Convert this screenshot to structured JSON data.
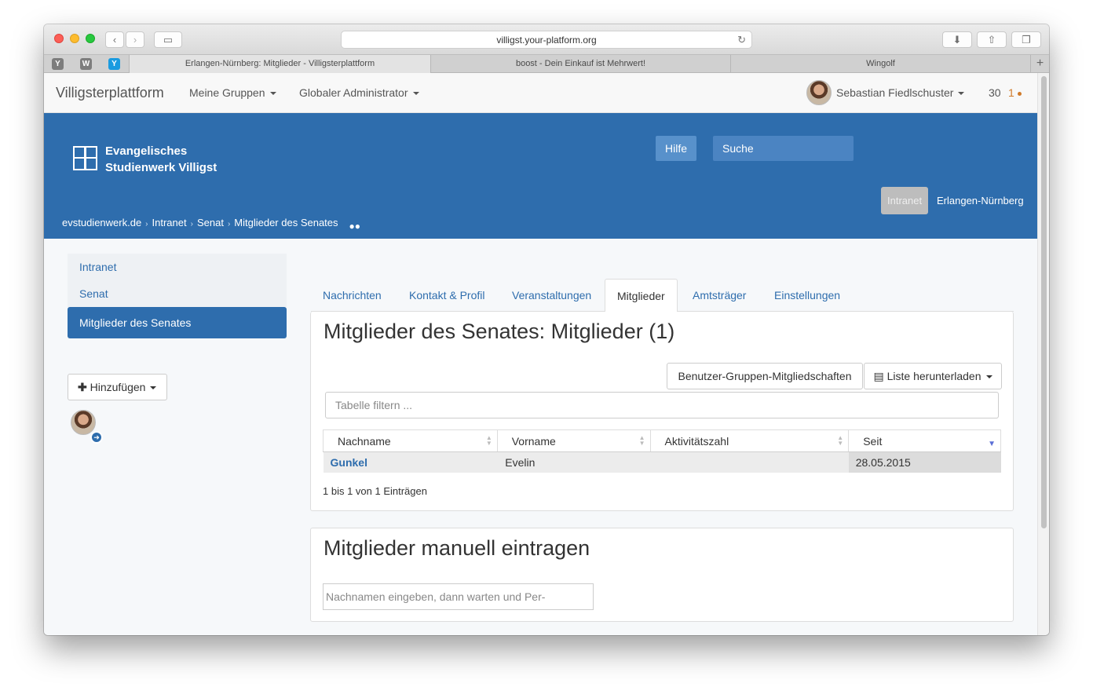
{
  "browser": {
    "url": "villigst.your-platform.org",
    "favicons": [
      "Y",
      "W",
      "Y"
    ],
    "tabs": [
      "Erlangen-Nürnberg: Mitglieder - Villigsterplattform",
      "boost - Dein Einkauf ist Mehrwert!",
      "Wingolf"
    ],
    "new_tab": "+"
  },
  "navbar": {
    "brand": "Villigsterplattform",
    "menu_groups": "Meine Gruppen",
    "menu_admin": "Globaler Administrator",
    "user_name": "Sebastian Fiedlschuster",
    "count": "30",
    "notifications": "1"
  },
  "banner": {
    "logo_line1": "Evangelisches",
    "logo_line2": "Studienwerk Villigst",
    "help": "Hilfe",
    "search_placeholder": "Suche",
    "pills": [
      "Intranet",
      "Erlangen-Nürnberg"
    ],
    "breadcrumb": [
      "evstudienwerk.de",
      "Intranet",
      "Senat",
      "Mitglieder des Senates"
    ]
  },
  "sidebar": {
    "items": [
      "Intranet",
      "Senat",
      "Mitglieder des Senates"
    ],
    "add_button": "Hinzufügen"
  },
  "tabs": [
    "Nachrichten",
    "Kontakt & Profil",
    "Veranstaltungen",
    "Mitglieder",
    "Amtsträger",
    "Einstellungen"
  ],
  "members": {
    "title": "Mitglieder des Senates: Mitglieder (1)",
    "memberships_button": "Benutzer-Gruppen-Mitgliedschaften",
    "download_button": "Liste herunterladen",
    "filter_placeholder": "Tabelle filtern ...",
    "columns": [
      "Nachname",
      "Vorname",
      "Aktivitätszahl",
      "Seit"
    ],
    "rows": [
      {
        "nachname": "Gunkel",
        "vorname": "Evelin",
        "aktivitaet": "",
        "seit": "28.05.2015"
      }
    ],
    "info": "1 bis 1 von 1 Einträgen"
  },
  "manual": {
    "title": "Mitglieder manuell eintragen",
    "input_placeholder": "Nachnamen eingeben, dann warten und Per-"
  }
}
